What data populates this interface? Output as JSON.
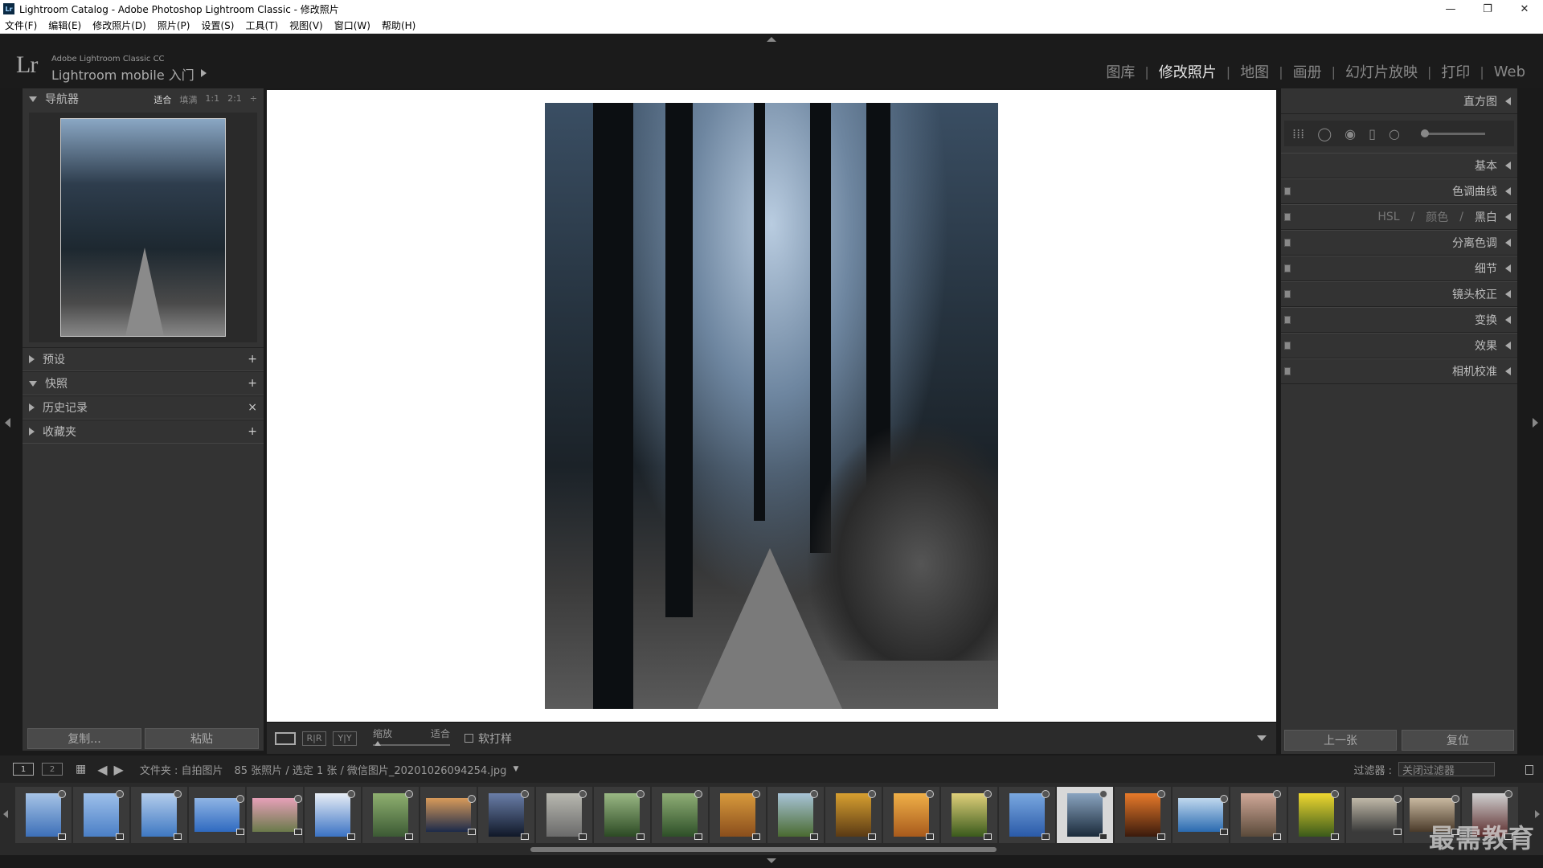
{
  "window": {
    "app_badge": "Lr",
    "title": "Lightroom Catalog - Adobe Photoshop Lightroom Classic - 修改照片",
    "min": "—",
    "max": "❐",
    "close": "✕"
  },
  "menu": [
    "文件(F)",
    "编辑(E)",
    "修改照片(D)",
    "照片(P)",
    "设置(S)",
    "工具(T)",
    "视图(V)",
    "窗口(W)",
    "帮助(H)"
  ],
  "identity": {
    "logo": "Lr",
    "sub": "Adobe Lightroom Classic CC",
    "main": "Lightroom mobile 入门"
  },
  "modules": [
    {
      "label": "图库",
      "active": false
    },
    {
      "label": "修改照片",
      "active": true
    },
    {
      "label": "地图",
      "active": false
    },
    {
      "label": "画册",
      "active": false
    },
    {
      "label": "幻灯片放映",
      "active": false
    },
    {
      "label": "打印",
      "active": false
    },
    {
      "label": "Web",
      "active": false
    }
  ],
  "navigator": {
    "title": "导航器",
    "zoom_fit": "适合",
    "zoom_fill": "填满",
    "zoom_1": "1:1",
    "zoom_2": "2:1",
    "zoom_more": "÷"
  },
  "left_sections": [
    {
      "label": "预设",
      "expanded": false,
      "action": "+"
    },
    {
      "label": "快照",
      "expanded": true,
      "action": "+"
    },
    {
      "label": "历史记录",
      "expanded": false,
      "action": "×"
    },
    {
      "label": "收藏夹",
      "expanded": false,
      "action": "+"
    }
  ],
  "left_buttons": {
    "copy": "复制...",
    "paste": "粘贴"
  },
  "toolbar": {
    "ab_label": "R|R",
    "yy_label": "Y|Y",
    "zoom_label": "缩放",
    "zoom_value": "适合",
    "softproof": "软打样"
  },
  "right_panel": {
    "histogram": "直方图",
    "basic": "基本",
    "tone_curve": "色调曲线",
    "hsl": "HSL",
    "hsl_sep": "/",
    "color": "颜色",
    "bw": "黑白",
    "split_tone": "分离色调",
    "detail": "细节",
    "lens": "镜头校正",
    "transform": "变换",
    "effects": "效果",
    "calibration": "相机校准",
    "prev": "上一张",
    "reset": "复位"
  },
  "filmstrip": {
    "mon1": "1",
    "mon2": "2",
    "folder_info": "文件夹 : 自拍图片",
    "count_info": "85 张照片 / 选定 1 张 /",
    "filename": "微信图片_20201026094254.jpg",
    "filter_label": "过滤器 :",
    "filter_value": "关闭过滤器",
    "selected_index": 18,
    "thumbs": [
      {
        "colors": [
          "#3c6fb8",
          "#a7c4e6"
        ],
        "wide": false
      },
      {
        "colors": [
          "#4a7fc6",
          "#9ec0ea"
        ],
        "wide": false
      },
      {
        "colors": [
          "#3e78c2",
          "#b4cdec"
        ],
        "wide": false
      },
      {
        "colors": [
          "#2f6ac0",
          "#8fb4e4"
        ],
        "wide": true
      },
      {
        "colors": [
          "#6a7a4a",
          "#e6a0b8"
        ],
        "wide": true
      },
      {
        "colors": [
          "#3a72c4",
          "#e8eef6"
        ],
        "wide": false
      },
      {
        "colors": [
          "#3c5a34",
          "#8fb070"
        ],
        "wide": false
      },
      {
        "colors": [
          "#1c2a4a",
          "#d89a5a"
        ],
        "wide": true
      },
      {
        "colors": [
          "#101828",
          "#6a7ea8"
        ],
        "wide": false
      },
      {
        "colors": [
          "#6a6a6a",
          "#b8b8b0"
        ],
        "wide": false
      },
      {
        "colors": [
          "#2c4a24",
          "#9ab884"
        ],
        "wide": false
      },
      {
        "colors": [
          "#2e5028",
          "#8fae76"
        ],
        "wide": false
      },
      {
        "colors": [
          "#8a4e1c",
          "#d89a3c"
        ],
        "wide": false
      },
      {
        "colors": [
          "#4a6a30",
          "#a8c4d8"
        ],
        "wide": false
      },
      {
        "colors": [
          "#5a3a14",
          "#d8a030"
        ],
        "wide": false
      },
      {
        "colors": [
          "#a85a1c",
          "#f0b048"
        ],
        "wide": false
      },
      {
        "colors": [
          "#3a5a1c",
          "#e0d07a"
        ],
        "wide": false
      },
      {
        "colors": [
          "#2a5aa8",
          "#7aa8e0"
        ],
        "wide": false
      },
      {
        "colors": [
          "#1a2a3a",
          "#8aa4c0"
        ],
        "wide": false
      },
      {
        "colors": [
          "#3a1a0c",
          "#e87a2a"
        ],
        "wide": false
      },
      {
        "colors": [
          "#2a6ab0",
          "#c0d8ee"
        ],
        "wide": true
      },
      {
        "colors": [
          "#5a4a3a",
          "#d0a898"
        ],
        "wide": false
      },
      {
        "colors": [
          "#3a5a1a",
          "#f0d830"
        ],
        "wide": false
      },
      {
        "colors": [
          "#3a3a3a",
          "#c0b8a8"
        ],
        "wide": true
      },
      {
        "colors": [
          "#4a3a2a",
          "#c8b8a0"
        ],
        "wide": true
      },
      {
        "colors": [
          "#5a2a2a",
          "#d0d0d0"
        ],
        "wide": false
      }
    ]
  },
  "watermark": "最需教育"
}
